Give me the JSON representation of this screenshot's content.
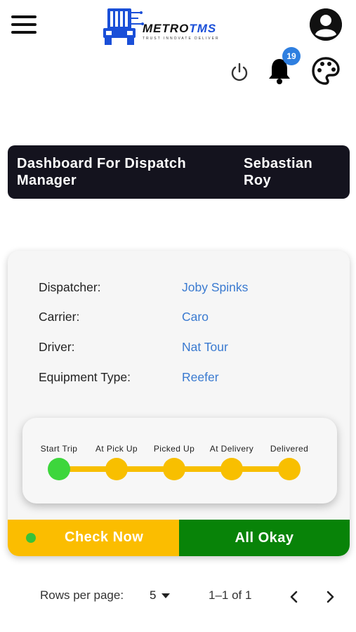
{
  "header": {
    "logo_name": "METROTMS",
    "logo_tagline": "TRUST  INNOVATE  DELIVER",
    "notification_count": "19",
    "icons": [
      "menu-icon",
      "truck-logo",
      "account-icon",
      "power-icon",
      "bell-icon",
      "palette-icon"
    ]
  },
  "banner": {
    "title": "Dashboard For Dispatch Manager",
    "user_name": "Sebastian Roy"
  },
  "details": {
    "dispatcher_label": "Dispatcher:",
    "dispatcher_value": "Joby Spinks",
    "carrier_label": "Carrier:",
    "carrier_value": "Caro",
    "driver_label": "Driver:",
    "driver_value": "Nat Tour",
    "equipment_label": "Equipment Type:",
    "equipment_value": "Reefer"
  },
  "progress": {
    "steps": [
      "Start Trip",
      "At Pick Up",
      "Picked Up",
      "At Delivery",
      "Delivered"
    ],
    "completed_steps": 1
  },
  "actions": {
    "check_now": "Check Now",
    "all_okay": "All Okay"
  },
  "pagination": {
    "rows_label": "Rows per page:",
    "rows_value": "5",
    "range": "1–1 of 1"
  },
  "colors": {
    "banner_bg": "#14131e",
    "link_blue": "#3a7ad0",
    "step_yellow": "#f8bf00",
    "step_done_green": "#3dd63c",
    "check_now_bg": "#fbbd00",
    "all_okay_bg": "#088308",
    "badge_blue": "#2f7fe0"
  }
}
